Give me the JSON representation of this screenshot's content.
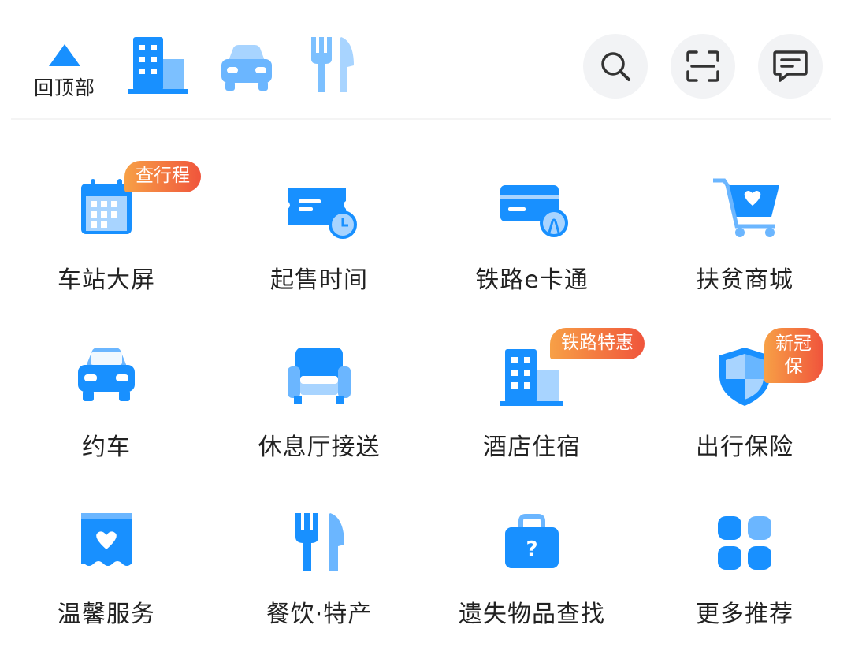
{
  "header": {
    "back_to_top_label": "回顶部",
    "quick_icons": [
      "building-icon",
      "car-icon",
      "fork-knife-icon"
    ],
    "actions": [
      "search-icon",
      "scan-icon",
      "message-icon"
    ]
  },
  "services": [
    {
      "label": "车站大屏",
      "icon": "calendar-icon",
      "badge": "查行程"
    },
    {
      "label": "起售时间",
      "icon": "ticket-clock-icon",
      "badge": ""
    },
    {
      "label": "铁路e卡通",
      "icon": "card-icon",
      "badge": ""
    },
    {
      "label": "扶贫商城",
      "icon": "shopping-cart-icon",
      "badge": ""
    },
    {
      "label": "约车",
      "icon": "car-icon",
      "badge": ""
    },
    {
      "label": "休息厅接送",
      "icon": "sofa-icon",
      "badge": ""
    },
    {
      "label": "酒店住宿",
      "icon": "building-icon",
      "badge": "铁路特惠"
    },
    {
      "label": "出行保险",
      "icon": "shield-icon",
      "badge": "新冠\n保"
    },
    {
      "label": "温馨服务",
      "icon": "heart-box-icon",
      "badge": ""
    },
    {
      "label": "餐饮·特产",
      "icon": "fork-knife-icon",
      "badge": ""
    },
    {
      "label": "遗失物品查找",
      "icon": "lost-bag-icon",
      "badge": ""
    },
    {
      "label": "更多推荐",
      "icon": "more-grid-icon",
      "badge": ""
    }
  ],
  "colors": {
    "primary": "#1890ff",
    "light": "#6bb6ff",
    "badge_start": "#f7a046",
    "badge_end": "#f0553c"
  }
}
